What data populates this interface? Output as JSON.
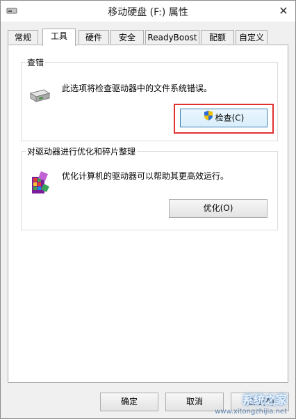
{
  "window": {
    "title": "移动硬盘 (F:) 属性",
    "close_symbol": "✕"
  },
  "tabs": [
    {
      "label": "常规"
    },
    {
      "label": "工具",
      "active": true
    },
    {
      "label": "硬件"
    },
    {
      "label": "安全"
    },
    {
      "label": "ReadyBoost"
    },
    {
      "label": "配额"
    },
    {
      "label": "自定义"
    }
  ],
  "error_check": {
    "title": "查错",
    "description": "此选项将检查驱动器中的文件系统错误。",
    "button_label": "检查(C)",
    "icons": [
      "drive-icon",
      "uac-shield-icon"
    ]
  },
  "optimize": {
    "title": "对驱动器进行优化和碎片整理",
    "description": "优化计算机的驱动器可以帮助其更高效运行。",
    "button_label": "优化(O)",
    "icons": [
      "defrag-icon"
    ]
  },
  "footer": {
    "ok_label": "确定",
    "cancel_label": "取消",
    "apply_label": "应用(A)"
  },
  "watermark": {
    "brand": "系统之家",
    "url": "www.xitongzhijia.net"
  },
  "colors": {
    "highlight": "#e03030",
    "accent": "#3c7fb1"
  }
}
